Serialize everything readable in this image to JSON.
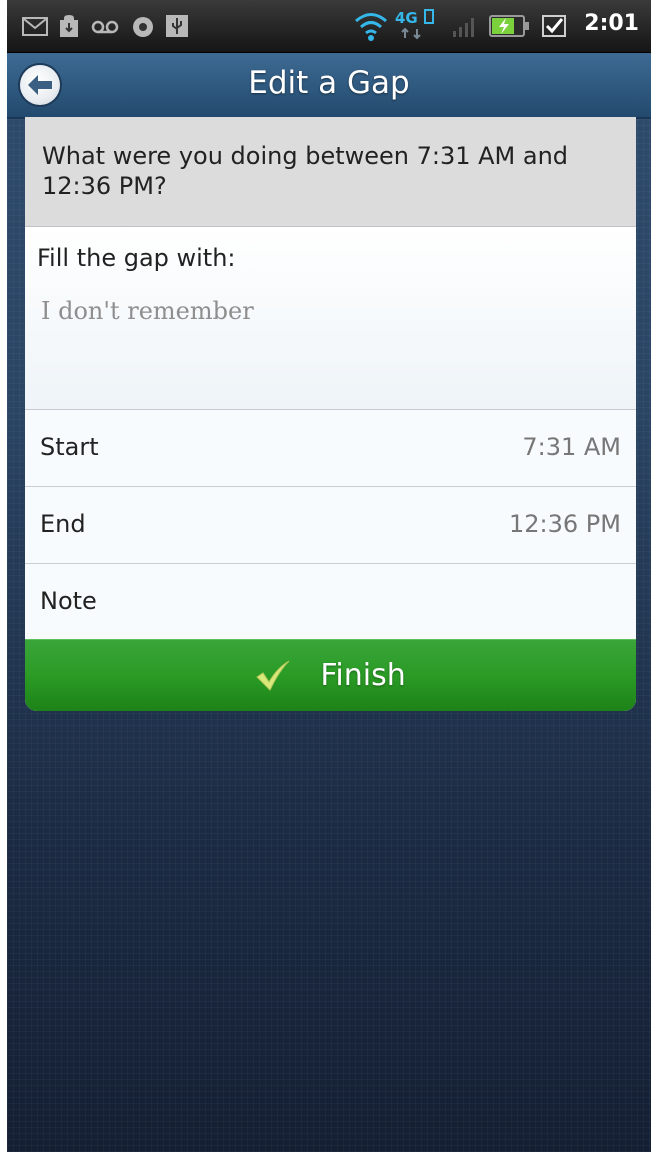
{
  "status_bar": {
    "time": "2:01",
    "network": "4G",
    "icons": [
      "gmail-icon",
      "download-icon",
      "voicemail-icon",
      "camera-icon",
      "usb-icon",
      "wifi-icon",
      "4g-lte-icon",
      "signal-icon",
      "battery-charging-icon",
      "checkbox-icon"
    ]
  },
  "header": {
    "title": "Edit a Gap",
    "back_icon": "back-arrow-icon"
  },
  "question": "What were you doing between 7:31 AM and 12:36 PM?",
  "fill": {
    "label": "Fill the gap with:",
    "placeholder": "I don't remember"
  },
  "rows": [
    {
      "label": "Start",
      "value": "7:31 AM"
    },
    {
      "label": "End",
      "value": "12:36 PM"
    },
    {
      "label": "Note",
      "value": ""
    }
  ],
  "finish": {
    "label": "Finish",
    "icon": "checkmark-icon"
  },
  "colors": {
    "finish_green": "#2a9b25",
    "title_blue": "#305a80",
    "background_navy": "#1c2c45"
  }
}
